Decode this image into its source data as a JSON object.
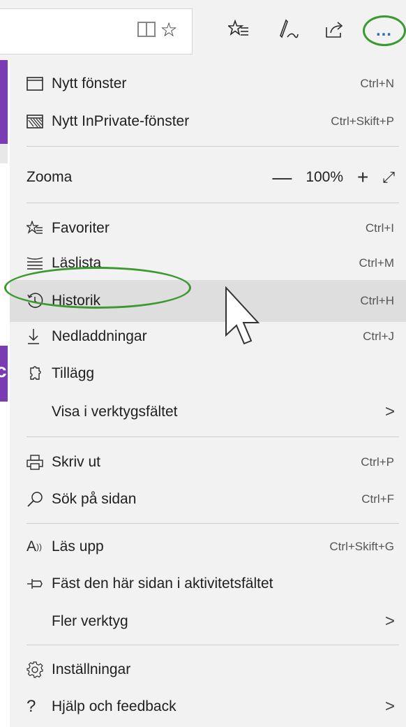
{
  "toolbar": {
    "icons": [
      "reading-view-icon",
      "favorite-star-icon",
      "favorites-hub-icon",
      "web-note-icon",
      "share-icon",
      "more-icon"
    ],
    "more_label": "…"
  },
  "page": {
    "partial_letter": "c"
  },
  "menu": {
    "new_window": {
      "label": "Nytt fönster",
      "shortcut": "Ctrl+N"
    },
    "new_private": {
      "label": "Nytt InPrivate-fönster",
      "shortcut": "Ctrl+Skift+P"
    },
    "zoom": {
      "label": "Zooma",
      "minus": "—",
      "value": "100%",
      "plus": "+",
      "fullscreen": "⤢"
    },
    "favorites": {
      "label": "Favoriter",
      "shortcut": "Ctrl+I"
    },
    "reading_list": {
      "label": "Läslista",
      "shortcut": "Ctrl+M"
    },
    "history": {
      "label": "Historik",
      "shortcut": "Ctrl+H"
    },
    "downloads": {
      "label": "Nedladdningar",
      "shortcut": "Ctrl+J"
    },
    "extensions": {
      "label": "Tillägg"
    },
    "show_in_toolbar": {
      "label": "Visa i verktygsfältet",
      "arrow": ">"
    },
    "print": {
      "label": "Skriv ut",
      "shortcut": "Ctrl+P"
    },
    "find": {
      "label": "Sök på sidan",
      "shortcut": "Ctrl+F"
    },
    "read_aloud": {
      "label": "Läs upp",
      "shortcut": "Ctrl+Skift+G"
    },
    "pin": {
      "label": "Fäst den här sidan i aktivitetsfältet"
    },
    "more_tools": {
      "label": "Fler verktyg",
      "arrow": ">"
    },
    "settings": {
      "label": "Inställningar"
    },
    "help": {
      "label": "Hjälp och feedback",
      "arrow": ">"
    }
  },
  "colors": {
    "highlight_oval": "#3a9a2f",
    "accent_purple": "#7a3bb3",
    "more_dots": "#2f6fb0"
  }
}
